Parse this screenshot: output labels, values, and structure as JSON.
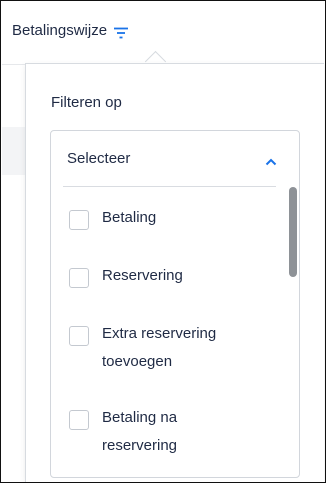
{
  "column": {
    "title": "Betalingswijze",
    "filter_icon": "filter-lines-icon"
  },
  "popover": {
    "title": "Filteren op",
    "dropdown": {
      "selected": "Selecteer",
      "chevron_icon": "chevron-up-icon",
      "options": [
        {
          "label": "Betaling",
          "checked": false
        },
        {
          "label": "Reservering",
          "checked": false
        },
        {
          "label": "Extra reservering toevoegen",
          "checked": false
        },
        {
          "label": "Betaling na reservering",
          "checked": false
        }
      ]
    }
  },
  "colors": {
    "accent": "#1a73e8",
    "text": "#1f2a44",
    "border": "#d2d6dc"
  }
}
